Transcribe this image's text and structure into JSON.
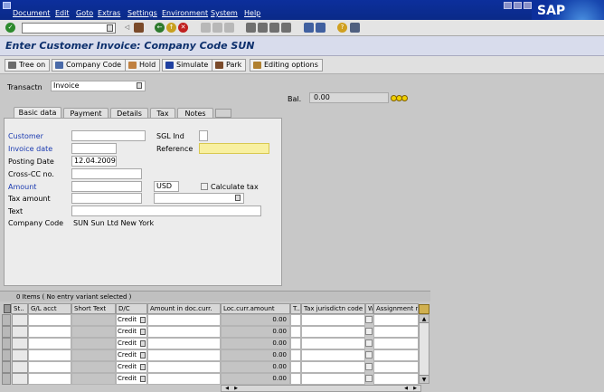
{
  "menu": {
    "items": [
      "Document",
      "Edit",
      "Goto",
      "Extras",
      "Settings",
      "Environment",
      "System",
      "Help"
    ]
  },
  "logo": "SAP",
  "title": "Enter Customer Invoice: Company Code SUN",
  "toolbar": {
    "buttons": [
      "Tree on",
      "Company Code",
      "Hold",
      "Simulate",
      "Park",
      "Editing options"
    ]
  },
  "header": {
    "transactn_label": "Transactn",
    "transactn_value": "Invoice",
    "bal_label": "Bal.",
    "bal_value": "0.00"
  },
  "tabs": [
    "Basic data",
    "Payment",
    "Details",
    "Tax",
    "Notes"
  ],
  "form": {
    "customer_label": "Customer",
    "invoice_date_label": "Invoice date",
    "posting_date_label": "Posting Date",
    "posting_date_value": "12.04.2009",
    "cross_cc_label": "Cross-CC no.",
    "amount_label": "Amount",
    "currency_value": "USD",
    "calculate_tax_label": "Calculate tax",
    "tax_amount_label": "Tax amount",
    "text_label": "Text",
    "company_code_label": "Company Code",
    "company_code_value": "SUN Sun Ltd New York",
    "sgl_ind_label": "SGL Ind",
    "reference_label": "Reference"
  },
  "table": {
    "status": "0 Items ( No entry variant selected )",
    "columns": [
      "St..",
      "G/L acct",
      "Short Text",
      "D/C",
      "Amount in doc.curr.",
      "Loc.curr.amount",
      "T..",
      "Tax jurisdictn code",
      "W..",
      "Assignment n"
    ],
    "rows": [
      {
        "dc": "Credit",
        "loc": "0.00"
      },
      {
        "dc": "Credit",
        "loc": "0.00"
      },
      {
        "dc": "Credit",
        "loc": "0.00"
      },
      {
        "dc": "Credit",
        "loc": "0.00"
      },
      {
        "dc": "Credit",
        "loc": "0.00"
      },
      {
        "dc": "Credit",
        "loc": "0.00"
      }
    ]
  },
  "colors": {
    "menubar": "#0c2f9c",
    "title_bg": "#d8dcec",
    "label_blue": "#1a3ab0",
    "reference_yellow": "#f8f0a0"
  }
}
